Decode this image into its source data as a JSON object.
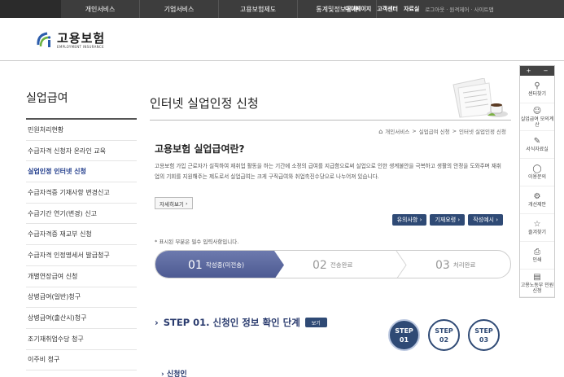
{
  "topnav": {
    "items": [
      "개인서비스",
      "기업서비스",
      "고용보험제도",
      "통계및정보공개"
    ],
    "links": [
      "마이페이지",
      "고객센터",
      "자료실"
    ],
    "utility": "로그아웃 · 원격제어 · 사이트맵"
  },
  "logo": {
    "ko": "고용보험",
    "en": "EMPLOYMENT INSURANCE"
  },
  "sidebar": {
    "title": "실업급여",
    "items": [
      {
        "label": "민원처리현황"
      },
      {
        "label": "수급자격 신청자 온라인 교육"
      },
      {
        "label": "실업인정 인터넷 신청"
      },
      {
        "label": "수급자격증 기재사항 변경신고"
      },
      {
        "label": "수급기간 연기(변경) 신고"
      },
      {
        "label": "수급자격증 재교부 신청"
      },
      {
        "label": "수급자격 인정명세서 발급청구"
      },
      {
        "label": "개별연장급여 신청"
      },
      {
        "label": "상병급여(일반)청구"
      },
      {
        "label": "상병급여(출산시)청구"
      },
      {
        "label": "조기재취업수당 청구"
      },
      {
        "label": "이주비 청구"
      }
    ]
  },
  "content": {
    "title": "인터넷 실업인정 신청",
    "breadcrumb": [
      "개인서비스",
      ">",
      "실업급여 신청",
      ">",
      "인터넷 실업인정 신청"
    ],
    "section_title": "고용보험 실업급여란?",
    "description": "고용보험 가입 근로자가 실직하여 재취업 활동을 하는 기간에 소정의 급여를 지급함으로써 실업으로 인한 생계불안을 극복하고 생활의 안정을 도와주며 재취업의 기회를 지원해주는 제도로서 실업급여는 크게 구직급여와 취업촉진수당으로 나누어져 있습니다.",
    "more_button": "자세히보기",
    "action_buttons": [
      "유의사항",
      "기재요령",
      "작성예시"
    ],
    "required_note": "* 표시된 부분은 필수 입력사항입니다.",
    "steps": [
      {
        "num": "01",
        "label": "작성중(미전송)"
      },
      {
        "num": "02",
        "label": "전송완료"
      },
      {
        "num": "03",
        "label": "처리완료"
      }
    ],
    "step_heading": "STEP 01. 신청인 정보 확인 단계",
    "view_button": "보기",
    "step_circles": [
      {
        "top": "STEP",
        "bottom": "01"
      },
      {
        "top": "STEP",
        "bottom": "02"
      },
      {
        "top": "STEP",
        "bottom": "03"
      }
    ],
    "sub_heading": "신청인"
  },
  "quick_menu": {
    "header": [
      "+",
      "−"
    ],
    "items": [
      {
        "icon": "location-pin-icon",
        "label": "센터찾기"
      },
      {
        "icon": "person-icon",
        "label": "실업급여 모의계산"
      },
      {
        "icon": "pencil-icon",
        "label": "서식자료실"
      },
      {
        "icon": "chat-bubble-icon",
        "label": "이용문의"
      },
      {
        "icon": "gear-icon",
        "label": "개선제안"
      },
      {
        "icon": "star-icon",
        "label": "즐겨찾기"
      },
      {
        "icon": "printer-icon",
        "label": "인쇄"
      },
      {
        "icon": "document-icon",
        "label": "고용노동부 민원신청"
      }
    ]
  },
  "colors": {
    "accent": "#2f4a75",
    "topbar": "#3d3d3d"
  }
}
